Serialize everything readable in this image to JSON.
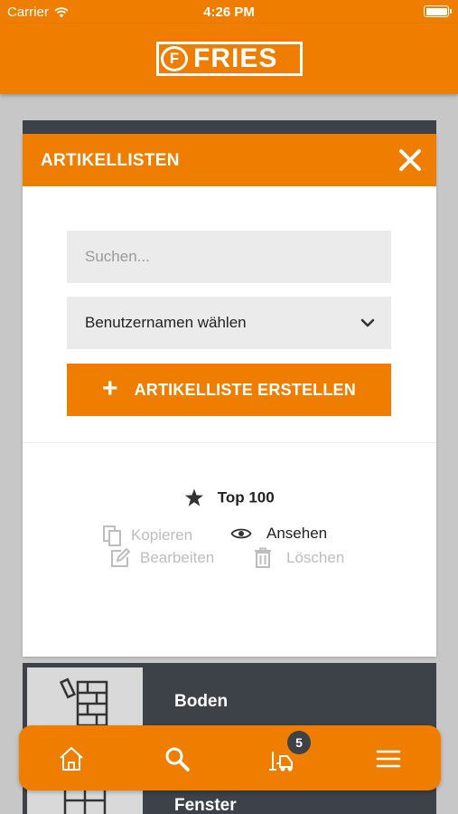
{
  "status_bar": {
    "carrier": "Carrier",
    "time": "4:26 PM"
  },
  "header": {
    "logo_text": "FRIES",
    "logo_mark": "F"
  },
  "modal": {
    "title": "ARTIKELLISTEN",
    "search_placeholder": "Suchen...",
    "user_select_label": "Benutzernamen wählen",
    "create_button_label": "ARTIKELLISTE ERSTELLEN",
    "list": {
      "name": "Top 100",
      "actions": {
        "copy": "Kopieren",
        "view": "Ansehen",
        "edit": "Bearbeiten",
        "delete": "Löschen"
      }
    }
  },
  "categories": [
    {
      "label": "Boden"
    },
    {
      "label": "Fenster"
    }
  ],
  "bottom_nav": {
    "cart_count": "5"
  },
  "colors": {
    "accent": "#ef7d00",
    "dark": "#3c4248",
    "background": "#c7c7c7"
  }
}
